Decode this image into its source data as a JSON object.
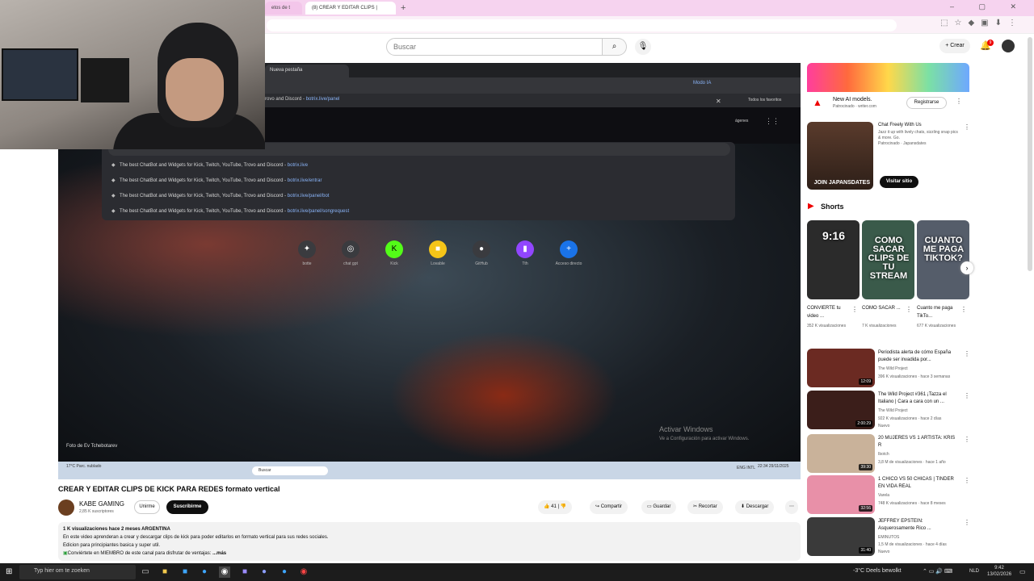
{
  "browser": {
    "tabs": [
      {
        "label": "etos de t"
      },
      {
        "label": "(8) CREAR Y EDITAR CLIPS |"
      }
    ],
    "new_tab": "+",
    "window_controls": "– ▢ ✕"
  },
  "youtube_header": {
    "search_placeholder": "Buscar",
    "search_icon": "search-icon",
    "mic_icon": "mic-icon",
    "create_label": "+ Crear",
    "notifications_count": "9"
  },
  "player": {
    "inner_tab_label": "Nueva pestaña",
    "modo_ia": "Modo IA",
    "inner_url_prefix": "rovo and Discord - ",
    "inner_url_link": "botrix.live/panel",
    "inner_favorites": "Todos los favoritos",
    "imagenes": "ágenes",
    "suggest_query": "botri",
    "suggestions": [
      {
        "text": "The best ChatBot and Widgets for Kick, Twitch, YouTube, Trovo and Discord - ",
        "url": "botrix.live"
      },
      {
        "text": "The best ChatBot and Widgets for Kick, Twitch, YouTube, Trovo and Discord - ",
        "url": "botrix.live/entrar"
      },
      {
        "text": "The best ChatBot and Widgets for Kick, Twitch, YouTube, Trovo and Discord - ",
        "url": "botrix.live/panel/bot"
      },
      {
        "text": "The best ChatBot and Widgets for Kick, Twitch, YouTube, Trovo and Discord - ",
        "url": "botrix.live/panel/songrequest"
      }
    ],
    "shortcuts": [
      {
        "label": "botte",
        "glyph": "✦"
      },
      {
        "label": "chat gpt",
        "glyph": "◎"
      },
      {
        "label": "Kick",
        "glyph": "K"
      },
      {
        "label": "Lovable",
        "glyph": "■"
      },
      {
        "label": "GitHub",
        "glyph": "●"
      },
      {
        "label": "Tth",
        "glyph": "▮"
      },
      {
        "label": "Acceso directo",
        "glyph": "+"
      }
    ],
    "photo_credit": "Foto de Ev Tchebotarev",
    "watermark_title": "Activar Windows",
    "watermark_sub": "Ve a Configuración para activar Windows.",
    "inner_weather": "17°C Parc. nublado",
    "inner_search": "Buscar",
    "inner_clock": "22:34 29/11/2025",
    "inner_lang": "ENG INTL"
  },
  "video": {
    "title": "CREAR Y EDITAR CLIPS DE KICK PARA REDES formato vertical",
    "channel": "KABE GAMING",
    "subscribers": "2,85 K suscriptores",
    "join_label": "Unirme",
    "subscribe_label": "Suscribirme",
    "likes": "41",
    "share_label": "Compartir",
    "save_label": "Guardar",
    "clip_label": "Recortar",
    "download_label": "Descargar",
    "desc_meta": "1 K visualizaciones  hace 2 meses  ARGENTINA",
    "desc_line1": "En este video aprenderan a crear y descargar clips de kick para poder editarlos en formato vertical para sus redes sociales.",
    "desc_line2": "Edicion para principiantes basica y super util.",
    "desc_line3": "Conviértete en MIEMBRO de este canal para disfrutar de ventajas:",
    "desc_more": "...más"
  },
  "sidebar": {
    "ad1_title": "New AI models.",
    "ad1_sponsor": "Patrocinado · writer.com",
    "ad1_button": "Registrarse",
    "ad2_title": "Chat Freely With Us",
    "ad2_desc": "Jazz it up with lively chats, sizzling snap pics & more. Go.",
    "ad2_sponsor": "Patrocinado · Japansdates",
    "ad2_thumb_text": "JOIN JAPANSDATES",
    "ad2_button": "Visitar sitio",
    "shorts_label": "Shorts",
    "shorts": [
      {
        "thumb": "9:16",
        "title": "CONVIERTE tu video ...",
        "views": "352 K visualizaciones",
        "bg": "#2b2b2b"
      },
      {
        "thumb": "COMO SACAR CLIPS DE TU STREAM",
        "title": "COMO SACAR ...",
        "views": "7 K visualizaciones",
        "bg": "#3a5a4a"
      },
      {
        "thumb": "CUANTO ME PAGA TIKTOK?",
        "title": "Cuanto me paga TikTo...",
        "views": "677 K visualizaciones",
        "bg": "#555d6a"
      }
    ],
    "videos": [
      {
        "title": "Periodista alerta de cómo España puede ser invadida por...",
        "channel": "The Wild Project",
        "meta": "396 K visualizaciones · hace 3 semanas",
        "duration": "12:09",
        "bg": "#6b2a22"
      },
      {
        "title": "The Wild Project #361 ¡Tazza el Italiano | Cara a cara con un ...",
        "channel": "The Wild Project",
        "meta": "922 K visualizaciones · hace 2 días",
        "extra": "Nuevo",
        "duration": "2:00:29",
        "bg": "#3b1e1a"
      },
      {
        "title": "20 MUJERES VS 1 ARTISTA: KRIS R",
        "channel": "Ibotch",
        "meta": "3,8 M de visualizaciones · hace 1 año",
        "duration": "39:30",
        "bg": "#c9b29a"
      },
      {
        "title": "1 CHICO VS 50 CHICAS | TINDER EN VIDA REAL",
        "channel": "Varela",
        "meta": "748 K visualizaciones · hace 8 meses",
        "duration": "32:56",
        "bg": "#e890a8"
      },
      {
        "title": "JEFFREY EPSTEIN: Asquerosamente Rico ...",
        "channel": "EMINUTOS",
        "meta": "1,5 M de visualizaciones · hace 4 días",
        "extra": "Nuevo",
        "duration": "31:40",
        "bg": "#3a3a3a"
      }
    ]
  },
  "taskbar": {
    "search_placeholder": "Typ hier om te zoeken",
    "weather": "-3°C  Deels bewolkt",
    "lang": "NLD",
    "time": "9:42",
    "date": "13/02/2026"
  },
  "colors": {
    "tab_strip": "#f6d3ef",
    "accent_red": "#ff0000",
    "link_blue": "#8ab4f8"
  }
}
